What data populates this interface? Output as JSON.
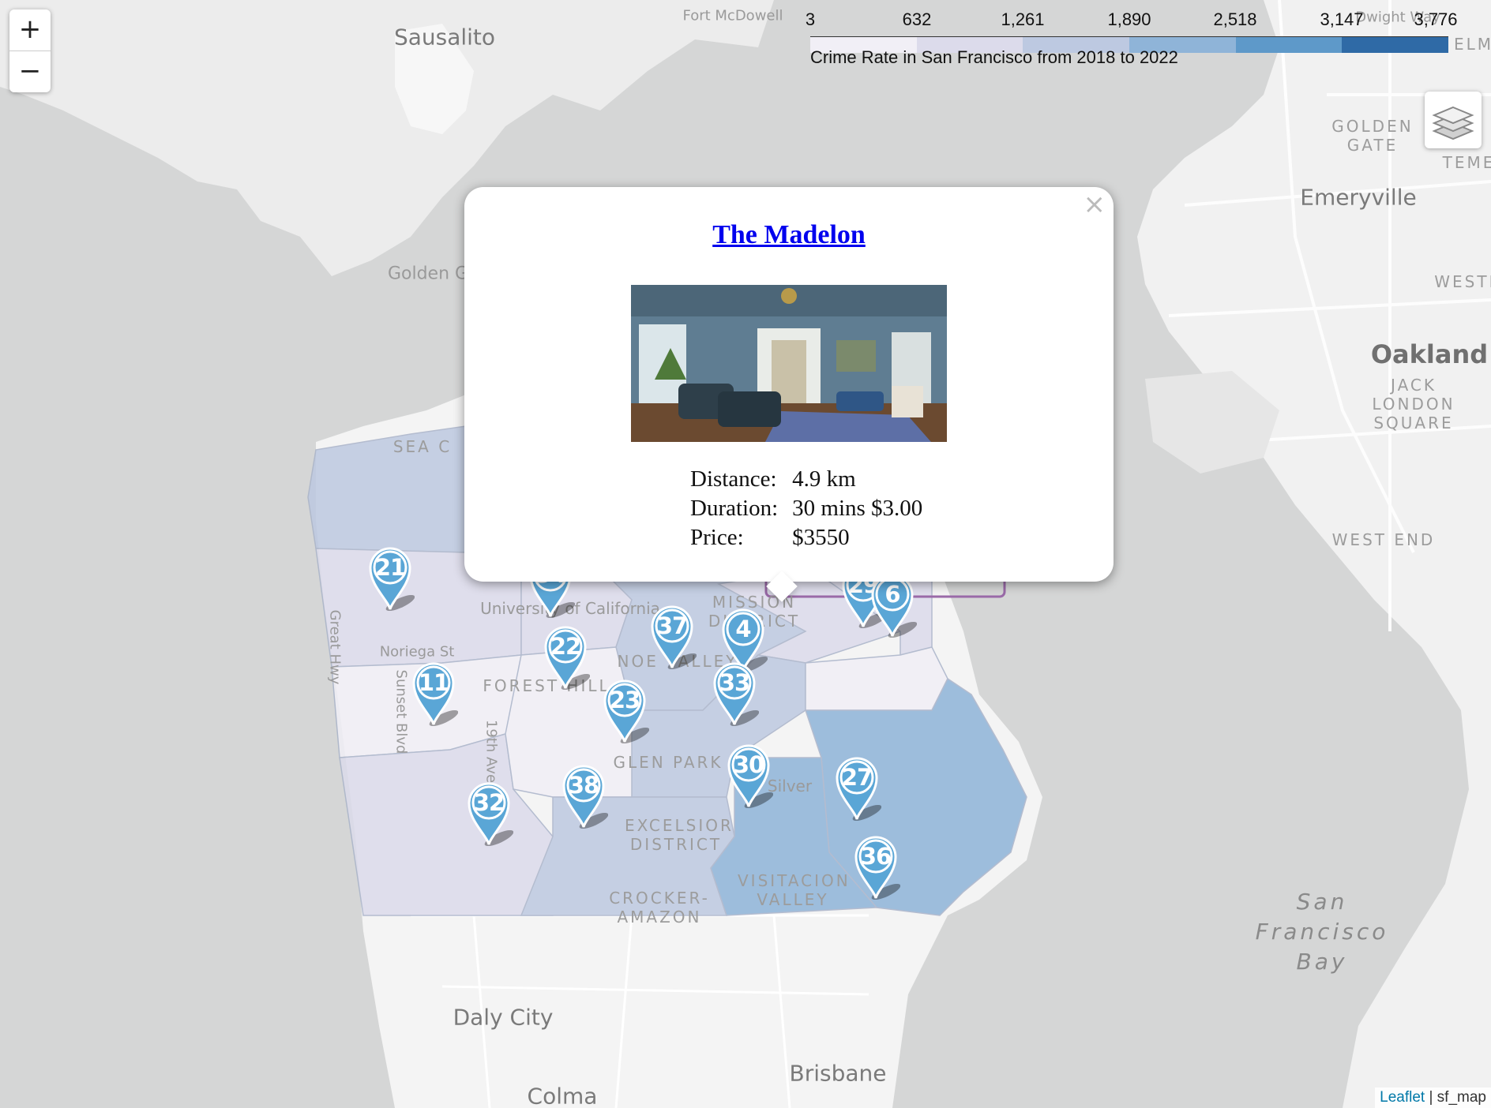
{
  "map": {
    "places": [
      {
        "name": "Fort McDowell",
        "cls": "street"
      },
      {
        "name": "Sausalito",
        "cls": "city"
      },
      {
        "name": "Golden G",
        "cls": "street"
      },
      {
        "name": "GOLDEN GATE",
        "cls": "hood"
      },
      {
        "name": "TEME",
        "cls": "hood"
      },
      {
        "name": "Emeryville",
        "cls": "city"
      },
      {
        "name": "WESTL",
        "cls": "hood"
      },
      {
        "name": "Oakland",
        "cls": "big"
      },
      {
        "name": "JACK LONDON SQUARE",
        "cls": "hood"
      },
      {
        "name": "WEST END",
        "cls": "hood"
      },
      {
        "name": "Dwight Way",
        "cls": "street"
      },
      {
        "name": "ELM",
        "cls": "hood"
      },
      {
        "name": "SEA C",
        "cls": "hood"
      },
      {
        "name": "University of California",
        "cls": "street"
      },
      {
        "name": "MISSION DISTRICT",
        "cls": "hood"
      },
      {
        "name": "NOE VALLEY",
        "cls": "hood"
      },
      {
        "name": "FOREST HILL",
        "cls": "hood"
      },
      {
        "name": "Noriega St",
        "cls": "street"
      },
      {
        "name": "Great Hwy",
        "cls": "street"
      },
      {
        "name": "Sunset Blvd",
        "cls": "street"
      },
      {
        "name": "19th Ave",
        "cls": "street"
      },
      {
        "name": "GLEN PARK",
        "cls": "hood"
      },
      {
        "name": "Silver",
        "cls": "street"
      },
      {
        "name": "EXCELSIOR DISTRICT",
        "cls": "hood"
      },
      {
        "name": "CROCKER-AMAZON",
        "cls": "hood"
      },
      {
        "name": "VISITACION VALLEY",
        "cls": "hood"
      },
      {
        "name": "San Francisco Bay",
        "cls": "water"
      },
      {
        "name": "Daly City",
        "cls": "city"
      },
      {
        "name": "Brisbane",
        "cls": "city"
      },
      {
        "name": "Colma",
        "cls": "city"
      }
    ],
    "zoom_in": "+",
    "zoom_out": "−",
    "colors": {
      "land": "#f3f3f3",
      "water": "#d5d6d6",
      "district_scale": [
        "#f1eff6",
        "#dcdbeb",
        "#bdc9e1",
        "#8fb4d8",
        "#5e99c9",
        "#2f6aa6"
      ]
    }
  },
  "legend": {
    "ticks": [
      "3",
      "632",
      "1,261",
      "1,890",
      "2,518",
      "3,147",
      "3,776"
    ],
    "caption": "Crime Rate in San Francisco from 2018 to 2022",
    "bins": [
      "#f1eff6",
      "#dcdbeb",
      "#bdc9e1",
      "#8fb4d8",
      "#5e99c9",
      "#2f6aa6"
    ]
  },
  "markers": [
    "21",
    "34",
    "37",
    "4",
    "22",
    "11",
    "33",
    "23",
    "30",
    "27",
    "38",
    "32",
    "36",
    "29",
    "6"
  ],
  "popup": {
    "title": "The Madelon",
    "close": "×",
    "rows": [
      {
        "label": "Distance:",
        "value": "4.9 km"
      },
      {
        "label": "Duration:",
        "value": "30 mins $3.00"
      },
      {
        "label": "Price:",
        "value": "$3550"
      }
    ]
  },
  "attribution": {
    "link": "Leaflet",
    "text": " | sf_map"
  }
}
